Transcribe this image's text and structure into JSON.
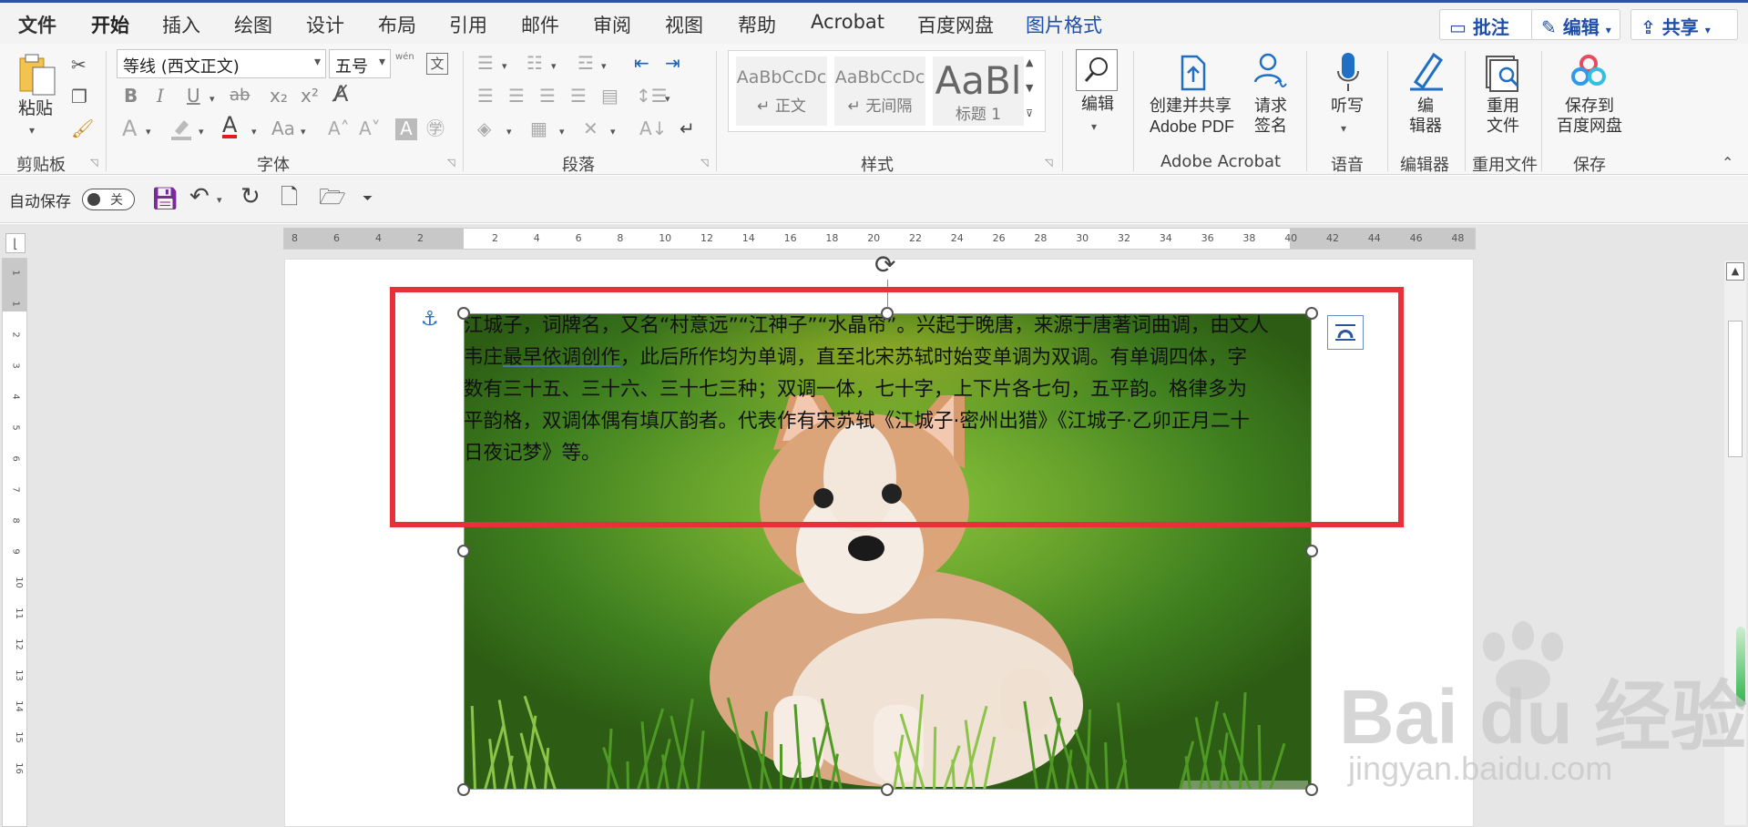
{
  "menu": {
    "tabs": [
      "文件",
      "开始",
      "插入",
      "绘图",
      "设计",
      "布局",
      "引用",
      "邮件",
      "审阅",
      "视图",
      "帮助",
      "Acrobat",
      "百度网盘",
      "图片格式"
    ],
    "active": "开始",
    "right_buttons": {
      "comment": "批注",
      "edit": "编辑",
      "share": "共享"
    }
  },
  "ribbon": {
    "clipboard": {
      "paste": "粘贴",
      "group": "剪贴板"
    },
    "font": {
      "name": "等线 (西文正文)",
      "size": "五号",
      "group": "字体",
      "bold": "B",
      "italic": "I",
      "underline": "U",
      "strike": "ab",
      "sub": "x₂",
      "sup": "x²",
      "color_letter": "A",
      "aa": "Aa",
      "wen": "wén",
      "wen_char": "文"
    },
    "paragraph": {
      "group": "段落"
    },
    "styles": {
      "group": "样式",
      "items": [
        {
          "preview": "AaBbCcDc",
          "name": "↵ 正文"
        },
        {
          "preview": "AaBbCcDc",
          "name": "↵ 无间隔"
        },
        {
          "preview": "AaBl",
          "name": "标题 1"
        }
      ]
    },
    "editing": {
      "label": "编辑"
    },
    "acrobat": {
      "create_line1": "创建并共享",
      "create_line2": "Adobe PDF",
      "sign_line1": "请求",
      "sign_line2": "签名",
      "group": "Adobe Acrobat"
    },
    "voice": {
      "dictate": "听写",
      "group": "语音"
    },
    "editor": {
      "line1": "编",
      "line2": "辑器",
      "group": "编辑器"
    },
    "reuse": {
      "line1": "重用",
      "line2": "文件",
      "group": "重用文件"
    },
    "baidu": {
      "line1": "保存到",
      "line2": "百度网盘",
      "group": "保存"
    }
  },
  "qat": {
    "autosave": "自动保存",
    "toggle": "关"
  },
  "ruler": {
    "h_left": [
      "8",
      "6",
      "4",
      "2"
    ],
    "h_main": [
      "2",
      "4",
      "6",
      "8",
      "10",
      "12",
      "14",
      "16",
      "18",
      "20",
      "22",
      "24",
      "26",
      "28",
      "30",
      "32",
      "34",
      "36",
      "38",
      "40",
      "42",
      "44",
      "46",
      "48"
    ],
    "v": [
      "1",
      "1",
      "2",
      "3",
      "4",
      "5",
      "6",
      "7",
      "8",
      "9",
      "10",
      "11",
      "12",
      "13",
      "14",
      "15",
      "16"
    ]
  },
  "document": {
    "lines": [
      "江城子，词牌名，又名“村意远”“江神子”“水晶帘”。兴起于晚唐，来源于唐著词曲调，由文人",
      "此后所作均为单调，直至北宋苏轼时始变单调为双调。有单调四体，字",
      "数有三十五、三十六、三十七三种；双调一体，七十字，上下片各七句，五平韵。格律多为",
      "平韵格，双调体偶有填仄韵者。代表作有宋苏轼《江城子·密州出猎》《江城子·乙卯正月二十",
      "日夜记梦》等。"
    ],
    "line2_prefix": "韦庄",
    "line2_underlined": "最早依调创作",
    "line2_comma": "，"
  },
  "watermark": {
    "logo": "Bai du 经验",
    "url": "jingyan.baidu.com"
  },
  "colors": {
    "accent": "#2b579a",
    "highlight_box": "#e8303a",
    "grass": "#6aa62d"
  }
}
